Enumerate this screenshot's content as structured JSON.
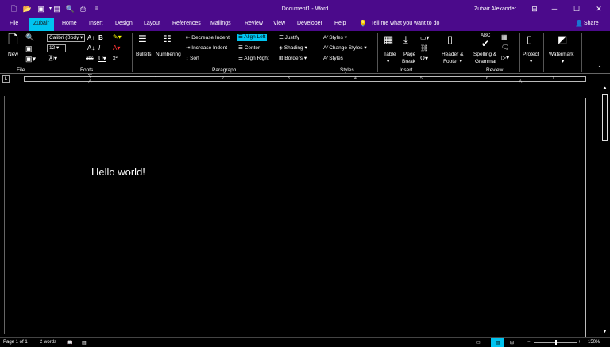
{
  "titlebar": {
    "document_title": "Document1 - Word",
    "user_name": "Zubair Alexander",
    "quick_access": [
      "new-icon",
      "open-icon",
      "save-icon",
      "undo-icon",
      "save-as-icon",
      "print-preview-icon",
      "print-icon",
      "customize-icon"
    ],
    "background": "#4b0a8b"
  },
  "tabs": [
    {
      "label": "File"
    },
    {
      "label": "Zubair",
      "active": true
    },
    {
      "label": "Home"
    },
    {
      "label": "Insert"
    },
    {
      "label": "Design"
    },
    {
      "label": "Layout"
    },
    {
      "label": "References"
    },
    {
      "label": "Mailings"
    },
    {
      "label": "Review"
    },
    {
      "label": "View"
    },
    {
      "label": "Developer"
    },
    {
      "label": "Help"
    }
  ],
  "tell_me": "Tell me what you want to do",
  "share_label": "Share",
  "accent": "#00c4f0",
  "ribbon": {
    "file_group": {
      "new_label": "New",
      "group_label": "File"
    },
    "fonts_group": {
      "font_name": "Calibri (Body",
      "font_size": "12",
      "group_label": "Fonts"
    },
    "paragraph_group": {
      "bullets": "Bullets",
      "numbering": "Numbering",
      "decrease_indent": "Decrease Indent",
      "increase_indent": "Increase Indent",
      "sort": "Sort",
      "align_left": "Align Left",
      "center": "Center",
      "align_right": "Align Right",
      "justify": "Justify",
      "shading": "Shading",
      "borders": "Borders",
      "group_label": "Paragraph"
    },
    "styles_group": {
      "styles": "Styles",
      "change_styles": "Change Styles",
      "styles2": "Styles",
      "group_label": "Styles"
    },
    "insert_group": {
      "table": "Table",
      "page": "Page",
      "break": "Break",
      "group_label": "Insert"
    },
    "header_footer": {
      "header": "Header &",
      "footer": "Footer"
    },
    "review_group": {
      "abc": "ABC",
      "spelling": "Spelling &",
      "grammar": "Grammar",
      "group_label": "Review"
    },
    "protect": "Protect",
    "watermark": "Watermark"
  },
  "ruler": {
    "numbers": [
      "1",
      "2",
      "3",
      "4",
      "5",
      "6",
      "7"
    ]
  },
  "document": {
    "text": "Hello world!"
  },
  "status": {
    "page": "Page 1 of 1",
    "words": "2 words",
    "zoom": "150%"
  }
}
